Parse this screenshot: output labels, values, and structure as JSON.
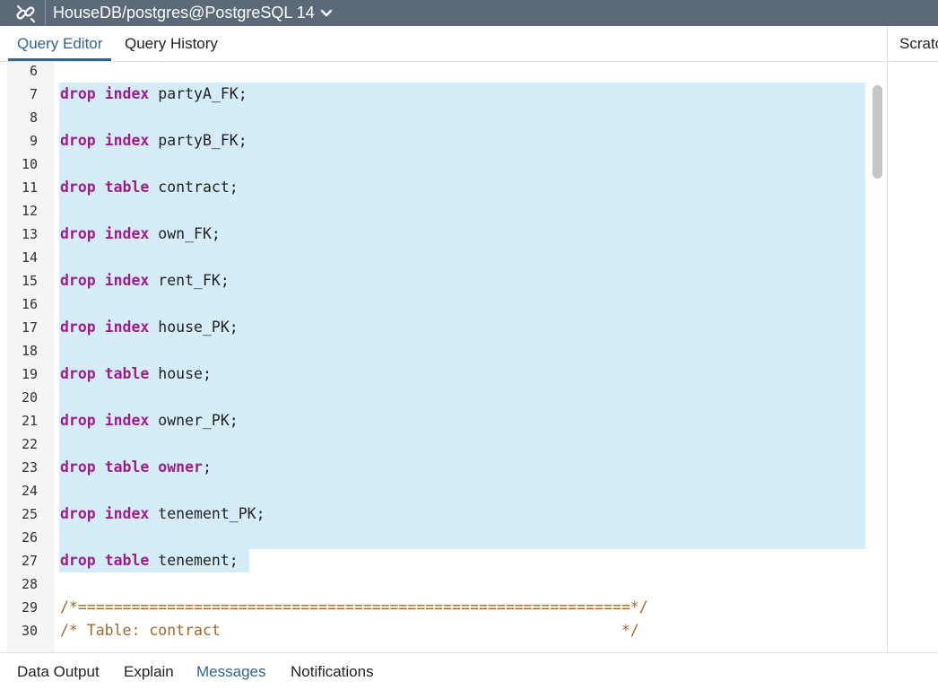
{
  "connection": {
    "label": "HouseDB/postgres@PostgreSQL 14",
    "icon": "link-icon",
    "chevron_icon": "chevron-down-icon"
  },
  "tabs": [
    {
      "label": "Query Editor",
      "active": true
    },
    {
      "label": "Query History",
      "active": false
    }
  ],
  "scratch_pad": {
    "label": "Scratch Pad"
  },
  "editor": {
    "lines": [
      {
        "n": "6",
        "parts": []
      },
      {
        "n": "7",
        "parts": [
          {
            "t": "drop",
            "k": "kw"
          },
          {
            "t": " "
          },
          {
            "t": "index",
            "k": "kw"
          },
          {
            "t": " partyA_FK;"
          }
        ],
        "sel": "full"
      },
      {
        "n": "8",
        "parts": [],
        "sel": "full"
      },
      {
        "n": "9",
        "parts": [
          {
            "t": "drop",
            "k": "kw"
          },
          {
            "t": " "
          },
          {
            "t": "index",
            "k": "kw"
          },
          {
            "t": " partyB_FK;"
          }
        ],
        "sel": "full"
      },
      {
        "n": "10",
        "parts": [],
        "sel": "full"
      },
      {
        "n": "11",
        "parts": [
          {
            "t": "drop",
            "k": "kw"
          },
          {
            "t": " "
          },
          {
            "t": "table",
            "k": "kw"
          },
          {
            "t": " contract;"
          }
        ],
        "sel": "full"
      },
      {
        "n": "12",
        "parts": [],
        "sel": "full"
      },
      {
        "n": "13",
        "parts": [
          {
            "t": "drop",
            "k": "kw"
          },
          {
            "t": " "
          },
          {
            "t": "index",
            "k": "kw"
          },
          {
            "t": " own_FK;"
          }
        ],
        "sel": "full"
      },
      {
        "n": "14",
        "parts": [],
        "sel": "full"
      },
      {
        "n": "15",
        "parts": [
          {
            "t": "drop",
            "k": "kw"
          },
          {
            "t": " "
          },
          {
            "t": "index",
            "k": "kw"
          },
          {
            "t": " rent_FK;"
          }
        ],
        "sel": "full"
      },
      {
        "n": "16",
        "parts": [],
        "sel": "full"
      },
      {
        "n": "17",
        "parts": [
          {
            "t": "drop",
            "k": "kw"
          },
          {
            "t": " "
          },
          {
            "t": "index",
            "k": "kw"
          },
          {
            "t": " house_PK;"
          }
        ],
        "sel": "full"
      },
      {
        "n": "18",
        "parts": [],
        "sel": "full"
      },
      {
        "n": "19",
        "parts": [
          {
            "t": "drop",
            "k": "kw"
          },
          {
            "t": " "
          },
          {
            "t": "table",
            "k": "kw"
          },
          {
            "t": " house;"
          }
        ],
        "sel": "full"
      },
      {
        "n": "20",
        "parts": [],
        "sel": "full"
      },
      {
        "n": "21",
        "parts": [
          {
            "t": "drop",
            "k": "kw"
          },
          {
            "t": " "
          },
          {
            "t": "index",
            "k": "kw"
          },
          {
            "t": " owner_PK;"
          }
        ],
        "sel": "full"
      },
      {
        "n": "22",
        "parts": [],
        "sel": "full"
      },
      {
        "n": "23",
        "parts": [
          {
            "t": "drop",
            "k": "kw"
          },
          {
            "t": " "
          },
          {
            "t": "table",
            "k": "kw"
          },
          {
            "t": " "
          },
          {
            "t": "owner",
            "k": "kw"
          },
          {
            "t": ";"
          }
        ],
        "sel": "full"
      },
      {
        "n": "24",
        "parts": [],
        "sel": "full"
      },
      {
        "n": "25",
        "parts": [
          {
            "t": "drop",
            "k": "kw"
          },
          {
            "t": " "
          },
          {
            "t": "index",
            "k": "kw"
          },
          {
            "t": " tenement_PK;"
          }
        ],
        "sel": "full"
      },
      {
        "n": "26",
        "parts": [],
        "sel": "full"
      },
      {
        "n": "27",
        "parts": [
          {
            "t": "drop",
            "k": "kw"
          },
          {
            "t": " "
          },
          {
            "t": "table",
            "k": "kw"
          },
          {
            "t": " tenement;"
          }
        ],
        "sel": "partial"
      },
      {
        "n": "28",
        "parts": []
      },
      {
        "n": "29",
        "parts": [
          {
            "t": "/*==============================================================*/",
            "k": "cm"
          }
        ]
      },
      {
        "n": "30",
        "parts": [
          {
            "t": "/* Table: contract                                             */",
            "k": "cm"
          }
        ]
      }
    ]
  },
  "bottom_tabs": [
    {
      "label": "Data Output",
      "active": false
    },
    {
      "label": "Explain",
      "active": false
    },
    {
      "label": "Messages",
      "active": true
    },
    {
      "label": "Notifications",
      "active": false
    }
  ]
}
